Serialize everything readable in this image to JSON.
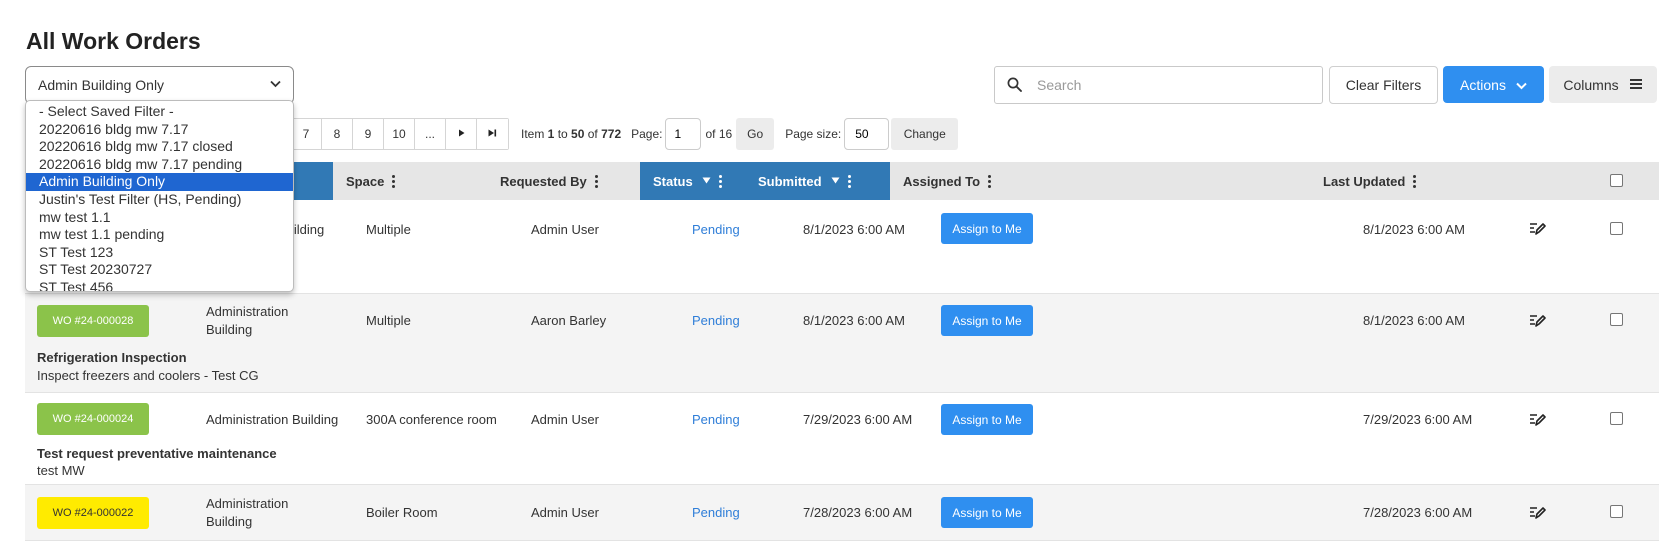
{
  "page": {
    "title": "All Work Orders"
  },
  "filter": {
    "selected": "Admin Building Only",
    "options": [
      "- Select Saved Filter -",
      "20220616 bldg mw 7.17",
      "20220616 bldg mw 7.17 closed",
      "20220616 bldg mw 7.17 pending",
      "Admin Building Only",
      "Justin's Test Filter (HS, Pending)",
      "mw test 1.1",
      "mw test 1.1 pending",
      "ST Test 123",
      "ST Test 20230727",
      "ST Test 456"
    ]
  },
  "toolbar": {
    "search_placeholder": "Search",
    "clear_filters": "Clear Filters",
    "actions": "Actions",
    "columns": "Columns"
  },
  "pager": {
    "pages": [
      "7",
      "8",
      "9",
      "10",
      "..."
    ],
    "item_prefix": "Item ",
    "item_from": "1",
    "item_to_word": " to ",
    "item_to": "50",
    "item_of_word": " of ",
    "item_total": "772",
    "page_label": "Page:",
    "page_value": "1",
    "of_pages": "of 16",
    "go": "Go",
    "page_size_label": "Page size:",
    "page_size_value": "50",
    "change": "Change"
  },
  "columns": {
    "space": "Space",
    "requested_by": "Requested By",
    "status": "Status",
    "submitted": "Submitted",
    "assigned_to": "Assigned To",
    "last_updated": "Last Updated"
  },
  "colors": {
    "accent": "#2f8ff0",
    "header_sorted": "#3179b5",
    "selected_option": "#1f66d1",
    "status_link": "#2f7ed8",
    "badge_green": "#8bc34a",
    "badge_yellow": "#ffeb00"
  },
  "rows": [
    {
      "wo": "",
      "building": "Building",
      "space": "Multiple",
      "requested_by": "Admin User",
      "status": "Pending",
      "submitted": "8/1/2023 6:00 AM",
      "assign": "Assign to Me",
      "last_updated": "8/1/2023 6:00 AM",
      "desc_title": "",
      "desc_body": ""
    },
    {
      "wo": "WO #24-000028",
      "badge_color": "green",
      "building_l1": "Administration",
      "building_l2": "Building",
      "space": "Multiple",
      "requested_by": "Aaron Barley",
      "status": "Pending",
      "submitted": "8/1/2023 6:00 AM",
      "assign": "Assign to Me",
      "last_updated": "8/1/2023 6:00 AM",
      "desc_title": "Refrigeration Inspection",
      "desc_body": "Inspect freezers and coolers - Test CG"
    },
    {
      "wo": "WO #24-000024",
      "badge_color": "green",
      "building": "Administration Building",
      "space": "300A conference room",
      "requested_by": "Admin User",
      "status": "Pending",
      "submitted": "7/29/2023 6:00 AM",
      "assign": "Assign to Me",
      "last_updated": "7/29/2023 6:00 AM",
      "desc_title": "Test request preventative maintenance",
      "desc_body": "test MW"
    },
    {
      "wo": "WO #24-000022",
      "badge_color": "yellow",
      "building_l1": "Administration",
      "building_l2": "Building",
      "space": "Boiler Room",
      "requested_by": "Admin User",
      "status": "Pending",
      "submitted": "7/28/2023 6:00 AM",
      "assign": "Assign to Me",
      "last_updated": "7/28/2023 6:00 AM"
    }
  ]
}
